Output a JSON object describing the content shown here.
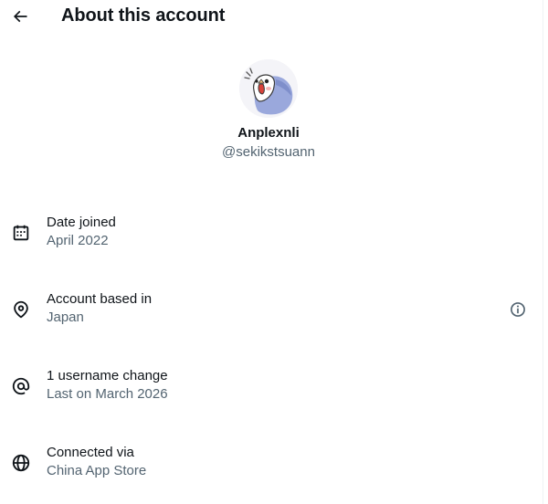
{
  "header": {
    "title": "About this account",
    "back_icon": "arrow-left-icon"
  },
  "profile": {
    "display_name": "Anplexnli",
    "handle": "@sekikstsuann"
  },
  "info_rows": [
    {
      "icon": "calendar-icon",
      "label": "Date joined",
      "value": "April 2022"
    },
    {
      "icon": "location-pin-icon",
      "label": "Account based in",
      "value": "Japan",
      "trailing_icon": "info-circle-icon"
    },
    {
      "icon": "at-sign-icon",
      "label": "1 username change",
      "value": "Last on March 2026"
    },
    {
      "icon": "globe-icon",
      "label": "Connected via",
      "value": "China App Store"
    }
  ],
  "colors": {
    "text_primary": "#0f1419",
    "text_secondary": "#536471",
    "background": "#ffffff",
    "avatar_bird": "#8fa0d8"
  }
}
